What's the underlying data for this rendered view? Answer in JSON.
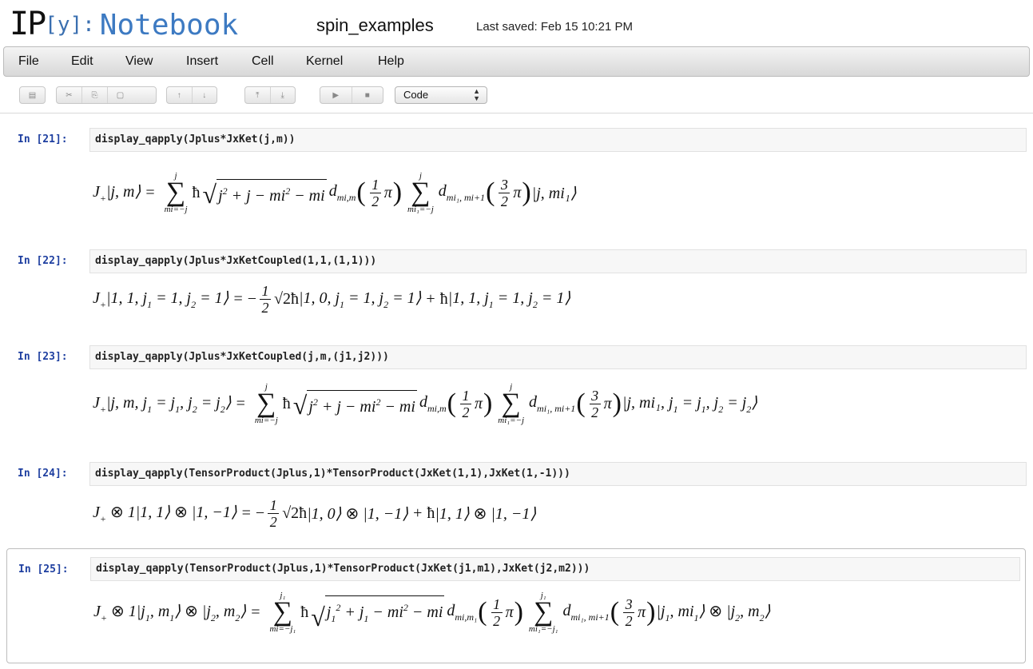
{
  "header": {
    "logo_ip": "IP",
    "logo_y": "[y]:",
    "logo_notebook": "Notebook",
    "notebook_name": "spin_examples",
    "last_saved": "Last saved: Feb 15 10:21 PM"
  },
  "menu": [
    "File",
    "Edit",
    "View",
    "Insert",
    "Cell",
    "Kernel",
    "Help"
  ],
  "toolbar": {
    "buttons": [
      {
        "icon": "save-icon",
        "glyph": "▤"
      },
      {
        "icon": "cut-icon",
        "glyph": "✂"
      },
      {
        "icon": "copy-icon",
        "glyph": "⎘"
      },
      {
        "icon": "paste-icon",
        "glyph": "▢"
      },
      {
        "icon": "move-up-icon",
        "glyph": "↑"
      },
      {
        "icon": "move-down-icon",
        "glyph": "↓"
      },
      {
        "icon": "insert-above-icon",
        "glyph": "⤒"
      },
      {
        "icon": "insert-below-icon",
        "glyph": "⤓"
      },
      {
        "icon": "run-icon",
        "glyph": "▶"
      },
      {
        "icon": "stop-icon",
        "glyph": "■"
      }
    ],
    "cell_type": "Code"
  },
  "cells": [
    {
      "prompt": "In [21]:",
      "code": "display_qapply(Jplus*JxKet(j,m))",
      "output": "J₊|j, m⟩ = Σ ħ√(j² + j − mi² − mi) d^j_{mi,m}(½π) Σ d^j_{mi₁,mi+1}(3/2 π)|j, mi₁⟩"
    },
    {
      "prompt": "In [22]:",
      "code": "display_qapply(Jplus*JxKetCoupled(1,1,(1,1)))",
      "output": "J₊|1, 1, j₁ = 1, j₂ = 1⟩ = −½ √2ħ|1, 0, j₁ = 1, j₂ = 1⟩ + ħ|1, 1, j₁ = 1, j₂ = 1⟩"
    },
    {
      "prompt": "In [23]:",
      "code": "display_qapply(Jplus*JxKetCoupled(j,m,(j1,j2)))",
      "output": "J₊|j, m, j₁ = j₁, j₂ = j₂⟩ = Σ ħ√(j² + j − mi² − mi) d^j_{mi,m}(½π) Σ d^j_{mi₁,mi+1}(3/2 π)|j, mi₁, j₁ = j₁, j₂ = j₂⟩"
    },
    {
      "prompt": "In [24]:",
      "code": "display_qapply(TensorProduct(Jplus,1)*TensorProduct(JxKet(1,1),JxKet(1,-1)))",
      "output": "J₊ ⊗ 1|1, 1⟩ ⊗ |1, −1⟩ = −½ √2ħ|1, 0⟩ ⊗ |1, −1⟩ + ħ|1, 1⟩ ⊗ |1, −1⟩"
    },
    {
      "prompt": "In [25]:",
      "code": "display_qapply(TensorProduct(Jplus,1)*TensorProduct(JxKet(j1,m1),JxKet(j2,m2)))",
      "output": "J₊ ⊗ 1|j₁, m₁⟩ ⊗ |j₂, m₂⟩ = Σ ħ√(j₁² + j₁ − mi² − mi) d^{j₁}_{mi,m₁}(½π) Σ d^{j₁}_{mi₁,mi+1}(3/2 π)|j₁, mi₁⟩ ⊗ |j₂, m₂⟩"
    }
  ],
  "colors": {
    "prompt": "#1e3fa0",
    "logo_blue": "#3d7ac2",
    "operator": "#a0307a",
    "number": "#1a7a3a"
  }
}
